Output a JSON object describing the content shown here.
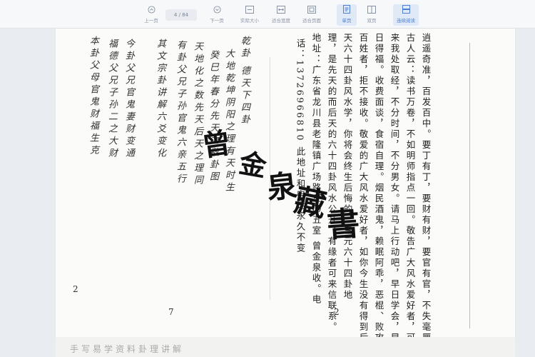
{
  "toolbar": {
    "prev_label": "上一页",
    "page_indicator": "4 / 84",
    "next_label": "下一页",
    "actual_size_label": "实际大小",
    "fit_width_label": "适合宽度",
    "fit_page_label": "适合页面",
    "single_page_label": "单页",
    "double_page_label": "双页",
    "continuous_label": "连续阅读"
  },
  "right_page": {
    "columns": [
      "逍遥奇准，百发百中。要丁有丁，要财有财，要官有官，不失毫厘。",
      "古人云：读书万卷，不如明师指点一回。敬告广大风水爱好者，可",
      "来我处取经，不分时间，不分男女。请马上行动吧，早日学会，早",
      "日得福。收费面谈，食宿自理。烟民酒鬼，赖眠阿乖，恶棍、败攻",
      "百姓者，拒不接收。敬爱的广大风水爱好者，如你今生没有得到后",
      "天六十四卦风水学，你将会终生后悔的，三元六十四卦地",
      "理，是先天的而后天的六十四卦风水公开，有缘者可来信联系。",
      "地址：广东省龙川县老隆镇广场路三〇五室     曾金泉收。电",
      "话：13726966810     此地址和电话永久不变"
    ],
    "page_number": "2"
  },
  "left_page": {
    "columns": [
      "乾卦  德天下四卦",
      "大地乾坤阴阳之理有天时生",
      "癸巳年春分先天之数卦图",
      "天地化之数先天后天之理同",
      "有卦父兄子孙官鬼六亲五行",
      "其文宗卦讲解六爻变化",
      "今卦父兄官鬼妻财变通",
      "福德父兄子孙二之大财",
      "本卦父母官鬼财福生克"
    ],
    "page_number_left": "2",
    "page_number_mid": "7"
  },
  "seal": {
    "chars": [
      "曾",
      "金",
      "泉",
      "藏",
      "書"
    ]
  },
  "bottom_strip_text": "手写易学资料卦理讲解"
}
